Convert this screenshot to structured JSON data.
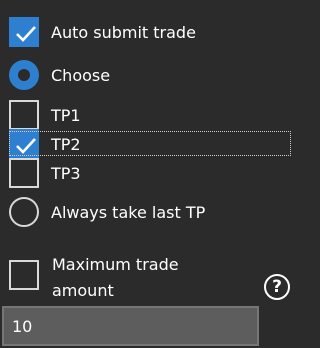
{
  "options": {
    "auto_submit_label": "Auto submit trade",
    "auto_submit_checked": true,
    "choose_label": "Choose",
    "choose_selected": true,
    "tp1_label": "TP1",
    "tp1_checked": false,
    "tp2_label": "TP2",
    "tp2_checked": true,
    "tp3_label": "TP3",
    "tp3_checked": false,
    "always_last_label": "Always take last TP",
    "always_last_selected": false,
    "max_trade_label_line1": "Maximum trade",
    "max_trade_label_line2": "amount",
    "max_trade_checked": false,
    "help_glyph": "?",
    "amount_value": "10"
  },
  "colors": {
    "background": "#2b2b2b",
    "accent": "#2f7fd0",
    "input_background": "#5d5d5d",
    "text": "#ffffff"
  },
  "icons": {
    "check": "checkmark-icon",
    "help": "question-circle-icon"
  }
}
